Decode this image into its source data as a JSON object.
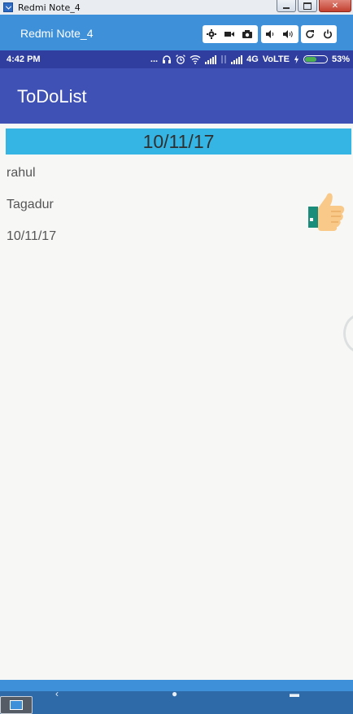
{
  "window": {
    "title": "Redmi Note_4"
  },
  "emulator": {
    "title": "Redmi Note_4",
    "tools": [
      "gear-icon",
      "video-camera-icon",
      "camera-icon",
      "volume-down-icon",
      "volume-up-icon",
      "rotate-icon",
      "power-icon"
    ]
  },
  "status": {
    "time": "4:42 PM",
    "dots": "...",
    "network": "4G",
    "volte": "VoLTE",
    "battery": "53%",
    "battery_level": 0.53
  },
  "app": {
    "title": "ToDoList"
  },
  "todo": {
    "header_date": "10/11/17",
    "name": "rahul",
    "task": "Tagadur",
    "date": "10/11/17"
  },
  "colors": {
    "app_bar": "#3f51b5",
    "status_bar": "#303f9f",
    "header": "#35b5e4",
    "emulator": "#3e90d8"
  }
}
